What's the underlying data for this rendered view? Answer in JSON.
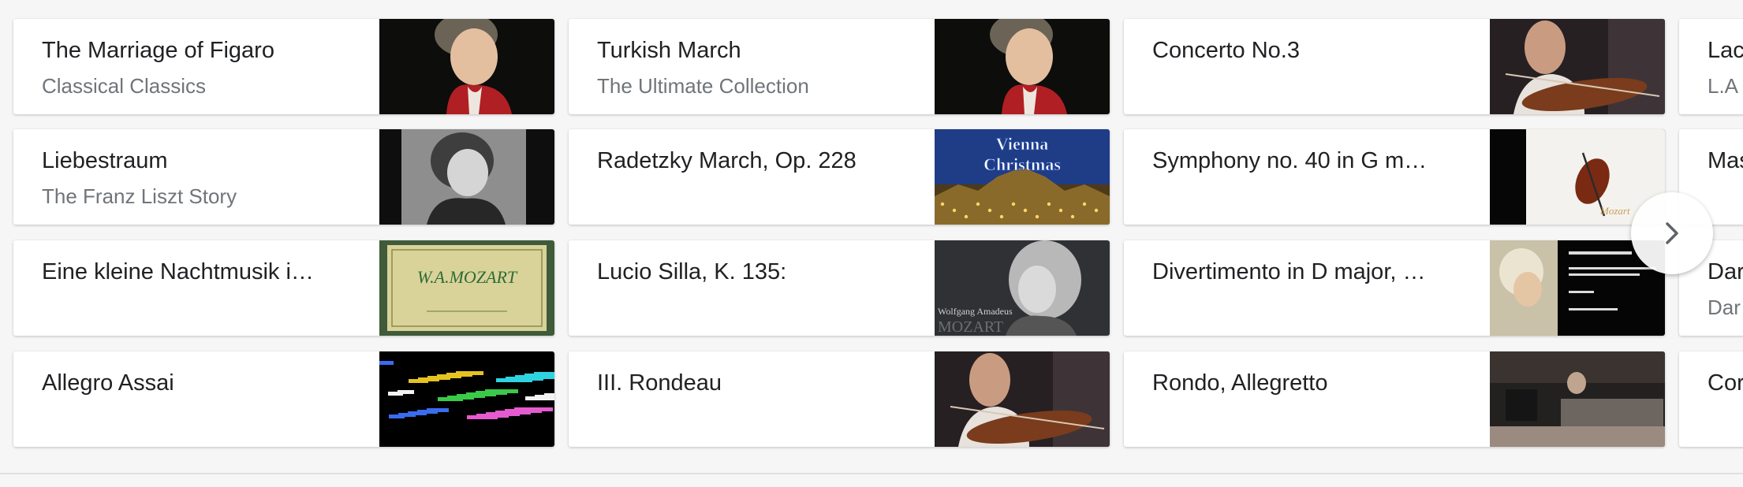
{
  "cards": [
    {
      "title": "The Marriage of Figaro",
      "subtitle": "Classical Classics",
      "thumb": "mozart-portrait"
    },
    {
      "title": "Turkish March",
      "subtitle": "The Ultimate Collection",
      "thumb": "mozart-portrait"
    },
    {
      "title": "Concerto No.3",
      "subtitle": "",
      "thumb": "violinist"
    },
    {
      "title": "Lac",
      "subtitle": "L.A",
      "thumb": "dark"
    },
    {
      "title": "Liebestraum",
      "subtitle": "The Franz Liszt Story",
      "thumb": "liszt-portrait"
    },
    {
      "title": "Radetzky March, Op. 228",
      "subtitle": "",
      "thumb": "vienna-christmas",
      "thumb_text": [
        "Vienna",
        "Christmas"
      ]
    },
    {
      "title": "Symphony no. 40 in G m…",
      "subtitle": "",
      "thumb": "violin-cover"
    },
    {
      "title": "Mas",
      "subtitle": "",
      "thumb": "dark"
    },
    {
      "title": "Eine kleine Nachtmusik i…",
      "subtitle": "",
      "thumb": "mozart-book",
      "thumb_text": [
        "W.A.MOZART"
      ]
    },
    {
      "title": "Lucio Silla, K. 135:",
      "subtitle": "",
      "thumb": "mozart-gray",
      "thumb_text": [
        "Wolfgang Amadeus",
        "MOZART"
      ]
    },
    {
      "title": "Divertimento in D major, …",
      "subtitle": "",
      "thumb": "divertimento-cover"
    },
    {
      "title": "Dar",
      "subtitle": "Dar",
      "thumb": "dark"
    },
    {
      "title": "Allegro Assai",
      "subtitle": "",
      "thumb": "piano-roll"
    },
    {
      "title": "III. Rondeau",
      "subtitle": "",
      "thumb": "violinist"
    },
    {
      "title": "Rondo, Allegretto",
      "subtitle": "",
      "thumb": "concert-stage"
    },
    {
      "title": "Cor",
      "subtitle": "",
      "thumb": "dark"
    }
  ],
  "next_button": {
    "icon": "chevron-right-icon"
  }
}
